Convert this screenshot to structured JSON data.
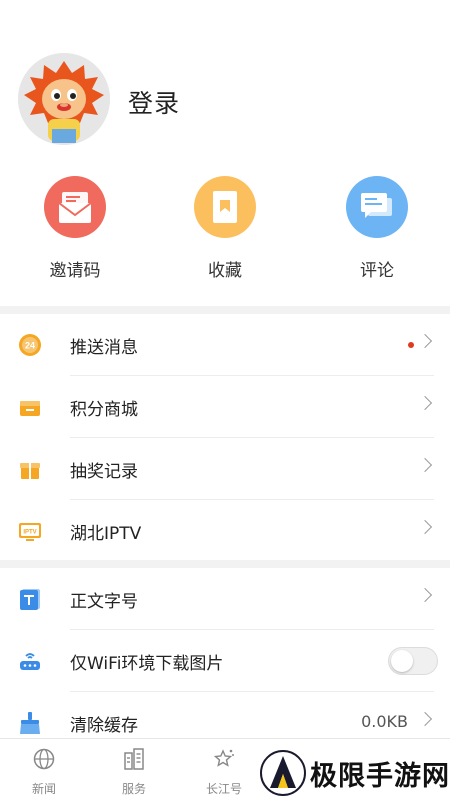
{
  "profile": {
    "login_label": "登录"
  },
  "quick_actions": [
    {
      "label": "邀请码",
      "icon": "envelope-icon",
      "color": "#f06a5e"
    },
    {
      "label": "收藏",
      "icon": "bookmark-icon",
      "color": "#fcbf5e"
    },
    {
      "label": "评论",
      "icon": "comment-icon",
      "color": "#6cb4f3"
    }
  ],
  "menu_group1": [
    {
      "label": "推送消息",
      "icon": "push-badge-icon",
      "has_dot": true
    },
    {
      "label": "积分商城",
      "icon": "store-icon"
    },
    {
      "label": "抽奖记录",
      "icon": "gift-icon"
    },
    {
      "label": "湖北IPTV",
      "icon": "tv-icon"
    }
  ],
  "menu_group2": [
    {
      "label": "正文字号",
      "icon": "font-size-icon"
    },
    {
      "label": "仅WiFi环境下载图片",
      "icon": "router-icon",
      "toggle_on": false
    },
    {
      "label": "清除缓存",
      "icon": "broom-icon",
      "value": "0.0KB"
    }
  ],
  "tabbar": [
    {
      "label": "新闻",
      "icon": "globe-icon"
    },
    {
      "label": "服务",
      "icon": "building-icon"
    },
    {
      "label": "长江号",
      "icon": "star-icon"
    }
  ],
  "watermark": {
    "text": "极限手游网"
  },
  "colors": {
    "accent": "#f5a623",
    "dot": "#e03a1f"
  }
}
